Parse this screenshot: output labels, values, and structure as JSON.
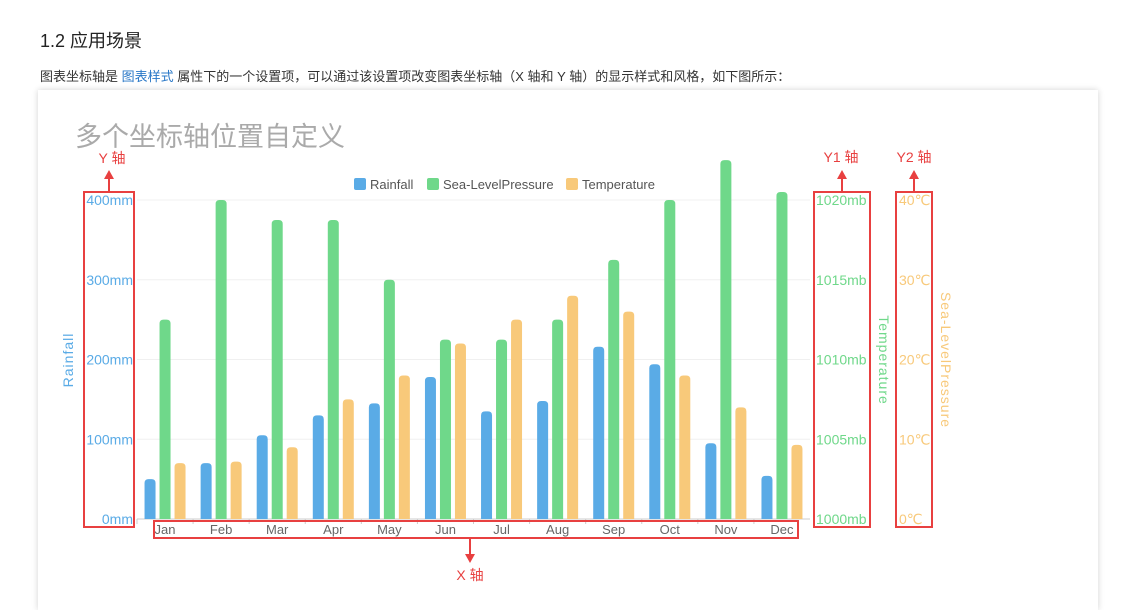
{
  "doc": {
    "section_title": "1.2 应用场景",
    "intro_before": "图表坐标轴是 ",
    "intro_link": "图表样式",
    "intro_after": " 属性下的一个设置项，可以通过该设置项改变图表坐标轴（X 轴和 Y 轴）的显示样式和风格，如下图所示："
  },
  "colors": {
    "rainfall": "#5aabe6",
    "pressure": "#6fd88a",
    "temperature": "#f8c97a",
    "annotation": "#e84040",
    "link": "#2a78c7"
  },
  "annotations": {
    "y_axis": "Y 轴",
    "y1_axis": "Y1 轴",
    "y2_axis": "Y2 轴",
    "x_axis": "X 轴"
  },
  "chart_data": {
    "type": "bar",
    "title": "多个坐标轴位置自定义",
    "categories": [
      "Jan",
      "Feb",
      "Mar",
      "Apr",
      "May",
      "Jun",
      "Jul",
      "Aug",
      "Sep",
      "Oct",
      "Nov",
      "Dec"
    ],
    "series": [
      {
        "name": "Rainfall",
        "axis": "left",
        "unit": "mm",
        "values": [
          50,
          70,
          105,
          130,
          145,
          178,
          135,
          148,
          216,
          194,
          95,
          54
        ]
      },
      {
        "name": "Sea-LevelPressure",
        "axis": "right1",
        "unit": "mb",
        "values": [
          1012.5,
          1020,
          1018.75,
          1018.75,
          1015,
          1011.25,
          1011.25,
          1012.5,
          1016.25,
          1020,
          1022.5,
          1020.5
        ]
      },
      {
        "name": "Temperature",
        "axis": "right2",
        "unit": "℃",
        "values": [
          7,
          7.2,
          9,
          15,
          18,
          22,
          25,
          28,
          26,
          18,
          14,
          9.3
        ]
      }
    ],
    "axes": {
      "left": {
        "ylabel": "Rainfall",
        "ylim": [
          0,
          400
        ],
        "ticks": [
          "0mm",
          "100mm",
          "200mm",
          "300mm",
          "400mm"
        ]
      },
      "right1": {
        "ylabel": "Temperature",
        "ylim": [
          1000,
          1020
        ],
        "ticks": [
          "1000mb",
          "1005mb",
          "1010mb",
          "1015mb",
          "1020mb"
        ]
      },
      "right2": {
        "ylabel": "Sea-LevelPressure",
        "ylim": [
          0,
          40
        ],
        "ticks": [
          "0℃",
          "10℃",
          "20℃",
          "30℃",
          "40℃"
        ]
      }
    },
    "legend": "top-center",
    "grid": true
  }
}
